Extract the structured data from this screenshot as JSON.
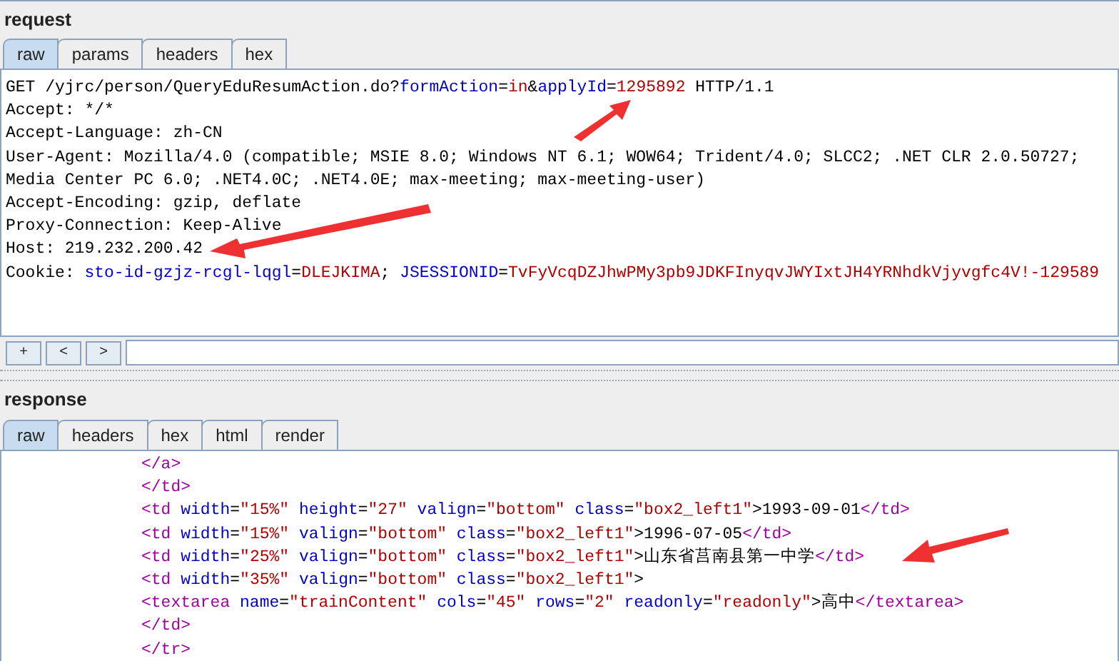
{
  "request": {
    "title": "request",
    "tabs": [
      {
        "label": "raw",
        "selected": true
      },
      {
        "label": "params",
        "selected": false
      },
      {
        "label": "headers",
        "selected": false
      },
      {
        "label": "hex",
        "selected": false
      }
    ],
    "lines": [
      [
        {
          "kind": "plain",
          "text": "GET /yjrc/person/QueryEduResumAction.do?"
        },
        {
          "kind": "key",
          "text": "formAction"
        },
        {
          "kind": "plain",
          "text": "="
        },
        {
          "kind": "value",
          "text": "in"
        },
        {
          "kind": "plain",
          "text": "&"
        },
        {
          "kind": "key",
          "text": "applyId"
        },
        {
          "kind": "plain",
          "text": "="
        },
        {
          "kind": "value",
          "text": "1295892"
        },
        {
          "kind": "plain",
          "text": " HTTP/1.1"
        }
      ],
      [
        {
          "kind": "plain",
          "text": "Accept: */*"
        }
      ],
      [
        {
          "kind": "plain",
          "text": "Accept-Language: zh-CN"
        }
      ],
      [
        {
          "kind": "plain",
          "text": "User-Agent: Mozilla/4.0 (compatible; MSIE 8.0; Windows NT 6.1; WOW64; Trident/4.0; SLCC2; .NET CLR 2.0.50727;"
        }
      ],
      [
        {
          "kind": "plain",
          "text": "Media Center PC 6.0; .NET4.0C; .NET4.0E; max-meeting; max-meeting-user)"
        }
      ],
      [
        {
          "kind": "plain",
          "text": "Accept-Encoding: gzip, deflate"
        }
      ],
      [
        {
          "kind": "plain",
          "text": "Proxy-Connection: Keep-Alive"
        }
      ],
      [
        {
          "kind": "plain",
          "text": "Host: 219.232.200.42"
        }
      ],
      [
        {
          "kind": "plain",
          "text": "Cookie: "
        },
        {
          "kind": "key",
          "text": "sto-id-gzjz-rcgl-lqgl"
        },
        {
          "kind": "plain",
          "text": "="
        },
        {
          "kind": "value",
          "text": "DLEJKIMA"
        },
        {
          "kind": "plain",
          "text": "; "
        },
        {
          "kind": "key",
          "text": "JSESSIONID"
        },
        {
          "kind": "plain",
          "text": "="
        },
        {
          "kind": "value",
          "text": "TvFyVcqDZJhwPMy3pb9JDKFInyqvJWYIxtJH4YRNhdkVjyvgfc4V!-129589"
        }
      ]
    ],
    "buttons": [
      "+",
      "<",
      ">"
    ]
  },
  "response": {
    "title": "response",
    "tabs": [
      {
        "label": "raw",
        "selected": true
      },
      {
        "label": "headers",
        "selected": false
      },
      {
        "label": "hex",
        "selected": false
      },
      {
        "label": "html",
        "selected": false
      },
      {
        "label": "render",
        "selected": false
      }
    ],
    "lines": [
      [
        {
          "kind": "tag",
          "text": "</a>"
        }
      ],
      [
        {
          "kind": "tag",
          "text": "</td>"
        }
      ],
      [
        {
          "kind": "tag",
          "text": "<td"
        },
        {
          "kind": "attr",
          "text": " width"
        },
        {
          "kind": "plain",
          "text": "="
        },
        {
          "kind": "str",
          "text": "\"15%\""
        },
        {
          "kind": "attr",
          "text": " height"
        },
        {
          "kind": "plain",
          "text": "="
        },
        {
          "kind": "str",
          "text": "\"27\""
        },
        {
          "kind": "attr",
          "text": " valign"
        },
        {
          "kind": "plain",
          "text": "="
        },
        {
          "kind": "str",
          "text": "\"bottom\""
        },
        {
          "kind": "attr",
          "text": " class"
        },
        {
          "kind": "plain",
          "text": "="
        },
        {
          "kind": "str",
          "text": "\"box2_left1\""
        },
        {
          "kind": "plain",
          "text": ">1993-09-01"
        },
        {
          "kind": "tag",
          "text": "</td>"
        }
      ],
      [
        {
          "kind": "tag",
          "text": "<td"
        },
        {
          "kind": "attr",
          "text": " width"
        },
        {
          "kind": "plain",
          "text": "="
        },
        {
          "kind": "str",
          "text": "\"15%\""
        },
        {
          "kind": "attr",
          "text": " valign"
        },
        {
          "kind": "plain",
          "text": "="
        },
        {
          "kind": "str",
          "text": "\"bottom\""
        },
        {
          "kind": "attr",
          "text": " class"
        },
        {
          "kind": "plain",
          "text": "="
        },
        {
          "kind": "str",
          "text": "\"box2_left1\""
        },
        {
          "kind": "plain",
          "text": ">1996-07-05"
        },
        {
          "kind": "tag",
          "text": "</td>"
        }
      ],
      [
        {
          "kind": "tag",
          "text": "<td"
        },
        {
          "kind": "attr",
          "text": " width"
        },
        {
          "kind": "plain",
          "text": "="
        },
        {
          "kind": "str",
          "text": "\"25%\""
        },
        {
          "kind": "attr",
          "text": " valign"
        },
        {
          "kind": "plain",
          "text": "="
        },
        {
          "kind": "str",
          "text": "\"bottom\""
        },
        {
          "kind": "attr",
          "text": " class"
        },
        {
          "kind": "plain",
          "text": "="
        },
        {
          "kind": "str",
          "text": "\"box2_left1\""
        },
        {
          "kind": "plain",
          "text": ">山东省莒南县第一中学"
        },
        {
          "kind": "tag",
          "text": "</td>"
        }
      ],
      [
        {
          "kind": "tag",
          "text": "<td"
        },
        {
          "kind": "attr",
          "text": " width"
        },
        {
          "kind": "plain",
          "text": "="
        },
        {
          "kind": "str",
          "text": "\"35%\""
        },
        {
          "kind": "attr",
          "text": " valign"
        },
        {
          "kind": "plain",
          "text": "="
        },
        {
          "kind": "str",
          "text": "\"bottom\""
        },
        {
          "kind": "attr",
          "text": " class"
        },
        {
          "kind": "plain",
          "text": "="
        },
        {
          "kind": "str",
          "text": "\"box2_left1\""
        },
        {
          "kind": "plain",
          "text": ">"
        }
      ],
      [
        {
          "kind": "tag",
          "text": "<textarea"
        },
        {
          "kind": "attr",
          "text": " name"
        },
        {
          "kind": "plain",
          "text": "="
        },
        {
          "kind": "str",
          "text": "\"trainContent\""
        },
        {
          "kind": "attr",
          "text": " cols"
        },
        {
          "kind": "plain",
          "text": "="
        },
        {
          "kind": "str",
          "text": "\"45\""
        },
        {
          "kind": "attr",
          "text": " rows"
        },
        {
          "kind": "plain",
          "text": "="
        },
        {
          "kind": "str",
          "text": "\"2\""
        },
        {
          "kind": "attr",
          "text": " readonly"
        },
        {
          "kind": "plain",
          "text": "="
        },
        {
          "kind": "str",
          "text": "\"readonly\""
        },
        {
          "kind": "plain",
          "text": ">高中"
        },
        {
          "kind": "tag",
          "text": "</textarea>"
        }
      ],
      [
        {
          "kind": "tag",
          "text": "</td>"
        }
      ],
      [
        {
          "kind": "tag",
          "text": "</tr>"
        }
      ]
    ]
  }
}
